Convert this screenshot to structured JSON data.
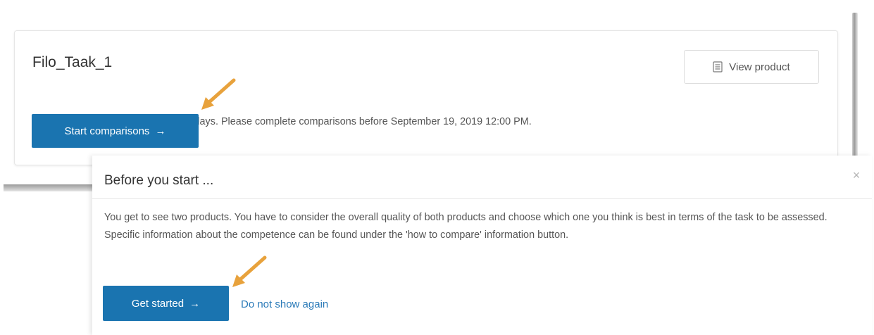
{
  "card": {
    "title": "Filo_Taak_1",
    "message": "Comparisons period will close in 20 days. Please complete comparisons before September 19, 2019 12:00 PM.",
    "view_product_label": "View product",
    "start_label": "Start comparisons",
    "arrow_glyph": "→"
  },
  "modal": {
    "title": "Before you start ...",
    "close_glyph": "×",
    "text": "You get to see two products. You have to consider the overall quality of both products and choose which one you think is best in terms of the task to be assessed. Specific information about the competence can be found under the 'how to compare' information button.",
    "get_started_label": "Get started",
    "arrow_glyph": "→",
    "do_not_show_label": "Do not show again"
  },
  "colors": {
    "primary": "#1a74b0",
    "link": "#2a7ab8",
    "annotation_arrow": "#e8a23c"
  },
  "icons": {
    "view_product": "document-icon",
    "close": "close-icon",
    "annotation": "pointer-arrow-icon"
  }
}
